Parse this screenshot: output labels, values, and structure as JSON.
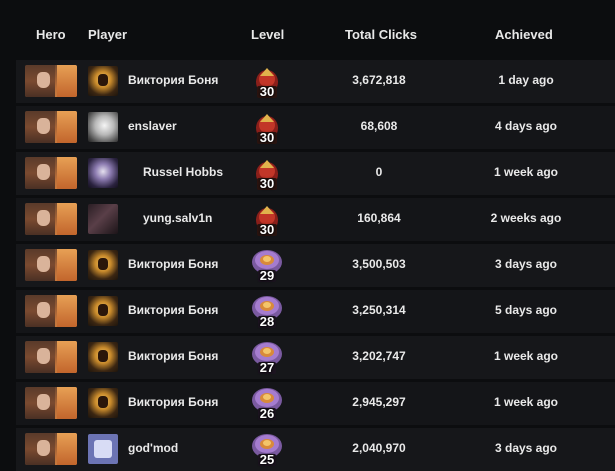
{
  "headers": {
    "hero": "Hero",
    "player": "Player",
    "level": "Level",
    "clicks": "Total Clicks",
    "achieved": "Achieved"
  },
  "rows": [
    {
      "player": "Виктория Боня",
      "avatar": "warrior-avatar",
      "steam": false,
      "level": "30",
      "badge": "winged-badge",
      "clicks": "3,672,818",
      "achieved": "1 day ago"
    },
    {
      "player": "enslaver",
      "avatar": "sketch-avatar",
      "steam": false,
      "level": "30",
      "badge": "winged-badge",
      "clicks": "68,608",
      "achieved": "4 days ago"
    },
    {
      "player": "Russel Hobbs",
      "avatar": "anime-avatar",
      "steam": true,
      "level": "30",
      "badge": "winged-badge",
      "clicks": "0",
      "achieved": "1 week ago"
    },
    {
      "player": "yung.salv1n",
      "avatar": "dark-avatar",
      "steam": true,
      "level": "30",
      "badge": "winged-badge",
      "clicks": "160,864",
      "achieved": "2 weeks ago"
    },
    {
      "player": "Виктория Боня",
      "avatar": "warrior-avatar",
      "steam": false,
      "level": "29",
      "badge": "round-badge",
      "clicks": "3,500,503",
      "achieved": "3 days ago"
    },
    {
      "player": "Виктория Боня",
      "avatar": "warrior-avatar",
      "steam": false,
      "level": "28",
      "badge": "round-badge",
      "clicks": "3,250,314",
      "achieved": "5 days ago"
    },
    {
      "player": "Виктория Боня",
      "avatar": "warrior-avatar",
      "steam": false,
      "level": "27",
      "badge": "round-badge",
      "clicks": "3,202,747",
      "achieved": "1 week ago"
    },
    {
      "player": "Виктория Боня",
      "avatar": "warrior-avatar",
      "steam": false,
      "level": "26",
      "badge": "round-badge",
      "clicks": "2,945,297",
      "achieved": "1 week ago"
    },
    {
      "player": "god'mod",
      "avatar": "mod-avatar",
      "steam": false,
      "level": "25",
      "badge": "round-badge",
      "clicks": "2,040,970",
      "achieved": "3 days ago"
    }
  ],
  "colors": {
    "background": "#0c0d0f",
    "row": "#16171a",
    "text": "#e9e9e9",
    "steam_icon": "#3b9fd6"
  }
}
